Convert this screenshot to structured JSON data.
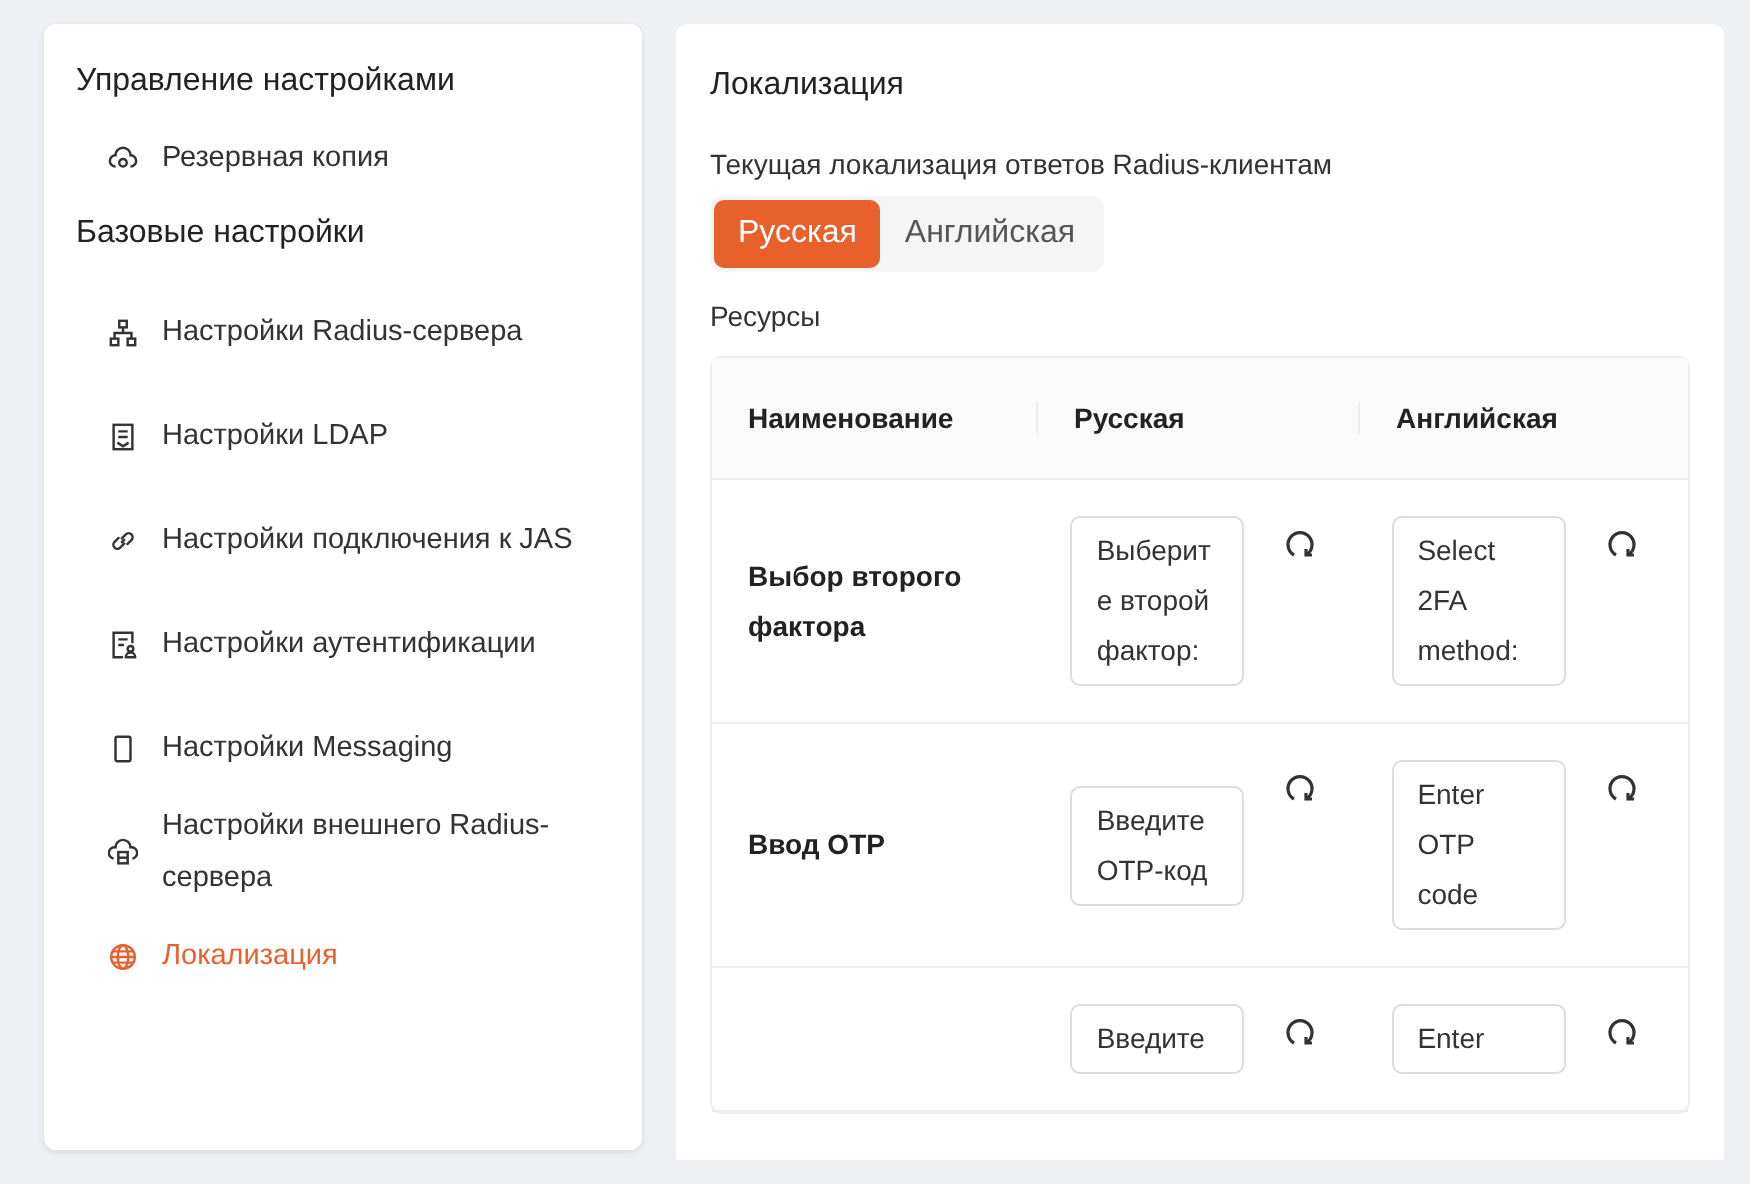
{
  "sidebar": {
    "sections": [
      {
        "title": "Управление настройками",
        "items": [
          {
            "label": "Резервная копия",
            "selected": false
          }
        ]
      },
      {
        "title": "Базовые настройки",
        "items": [
          {
            "label": "Настройки Radius-сервера",
            "selected": false
          },
          {
            "label": "Настройки LDAP",
            "selected": false
          },
          {
            "label": "Настройки подключения к JAS",
            "selected": false
          },
          {
            "label": "Настройки аутентификации",
            "selected": false
          },
          {
            "label": "Настройки Messaging",
            "selected": false
          },
          {
            "label": "Настройки внешнего Radius-сервера",
            "selected": false
          },
          {
            "label": "Локализация",
            "selected": true
          }
        ]
      }
    ]
  },
  "main": {
    "title": "Локализация",
    "current_label": "Текущая локализация ответов Radius-клиентам",
    "languages": [
      {
        "label": "Русская",
        "selected": true
      },
      {
        "label": "Английская",
        "selected": false
      }
    ],
    "resources_label": "Ресурсы",
    "table": {
      "columns": [
        "Наименование",
        "Русская",
        "Английская"
      ],
      "rows": [
        {
          "name": "Выбор второго фактора",
          "ru": "Выберите второй фактор:",
          "en": "Select 2FA method:"
        },
        {
          "name": "Ввод OTP",
          "ru": "Введите OTP-код",
          "en": "Enter OTP code"
        },
        {
          "name": "",
          "ru": "Введите",
          "en": "Enter"
        }
      ]
    }
  }
}
